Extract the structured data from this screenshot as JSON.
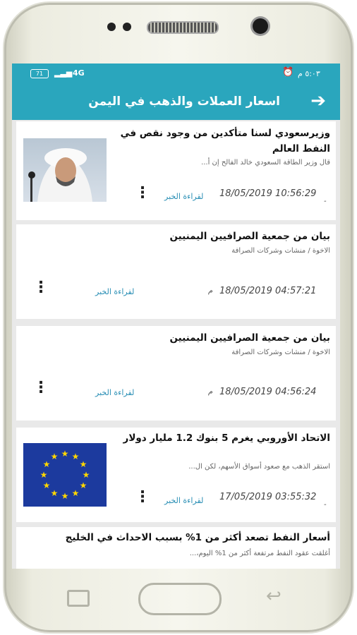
{
  "status_bar": {
    "battery": "71",
    "network": "4G",
    "time": "٥:٠٣ م"
  },
  "app_bar": {
    "title": "اسعار العملات والذهب في اليمن",
    "back_icon": "arrow-right-icon"
  },
  "colors": {
    "accent": "#2aa6bd",
    "link": "#2a8fb5"
  },
  "news": [
    {
      "headline": "وزيرسعودي لسنا متأكدين من وجود نقص في النفط العالم",
      "excerpt": "قال وزير الطاقة السعودي خالد الفالح إن أ...",
      "date": "18/05/2019 10:56:29",
      "date_suffix": "-",
      "read_more": "لقراءة الخبر",
      "thumb": "portrait"
    },
    {
      "headline": "بيان من جمعية الصرافيين اليمنيين",
      "excerpt": "الاخوة / منشات وشركات الصرافة",
      "date": "18/05/2019 04:57:21",
      "date_suffix": "م",
      "read_more": "لقراءة الخبر"
    },
    {
      "headline": "بيان من جمعية الصرافيين اليمنيين",
      "excerpt": "الاخوة / منشات وشركات الصرافة",
      "date": "18/05/2019 04:56:24",
      "date_suffix": "م",
      "read_more": "لقراءة الخبر"
    },
    {
      "headline": "الاتحاد الأوروبي يغرم 5 بنوك 1.2 مليار دولار",
      "excerpt": "استقر الذهب مع صعود أسواق الأسهم، لكن ال...",
      "date": "17/05/2019 03:55:32",
      "date_suffix": "-",
      "read_more": "لقراءة الخبر",
      "thumb": "eu-flag"
    },
    {
      "headline": "أسعار النفط تصعد أكثر من 1% بسبب الاحداث في الخليج",
      "excerpt": "أغلقت عقود النفط مرتفعة أكثر من 1% اليوم،..."
    }
  ]
}
